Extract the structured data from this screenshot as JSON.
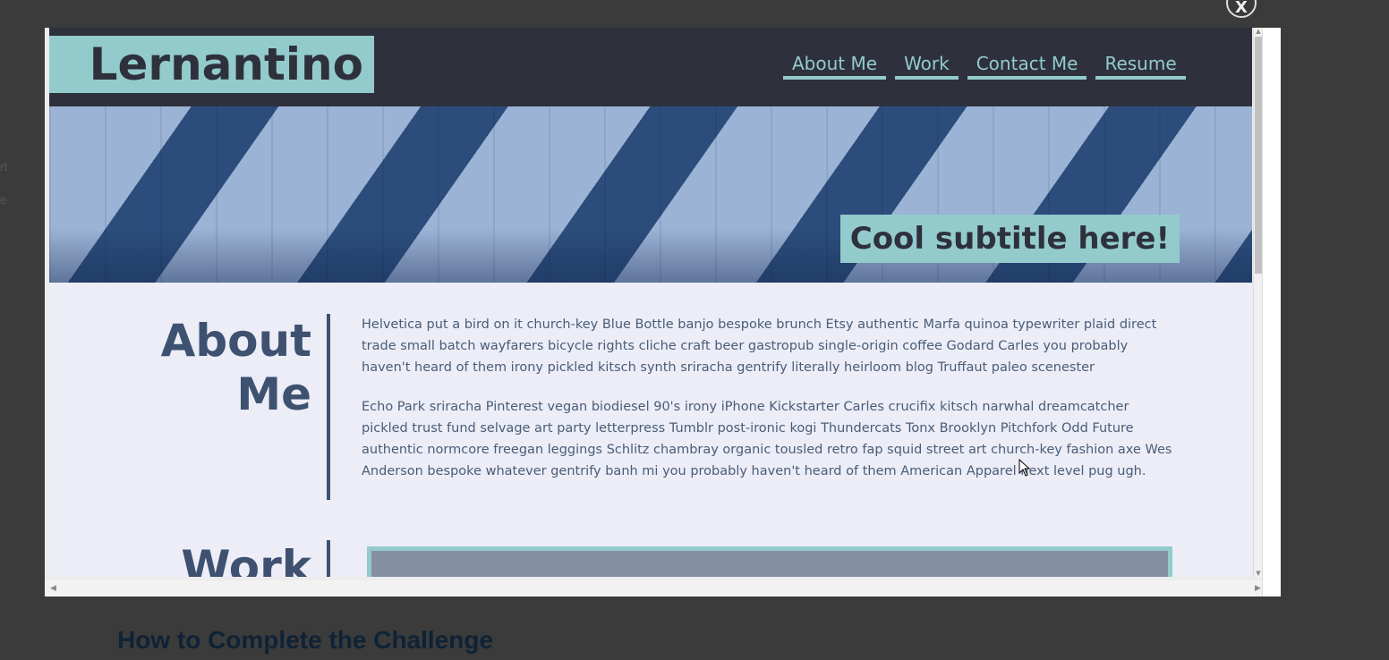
{
  "background": {
    "heading": "How to Complete the Challenge",
    "frag_1": "rt",
    "frag_2": "e"
  },
  "modal": {
    "close_label": "X"
  },
  "site": {
    "logo": "Lernantino",
    "nav": [
      "About Me",
      "Work",
      "Contact Me",
      "Resume"
    ],
    "hero_subtitle": "Cool subtitle here!",
    "about": {
      "title": "About Me",
      "paragraphs": [
        "Helvetica put a bird on it church-key Blue Bottle banjo bespoke brunch Etsy authentic Marfa quinoa typewriter plaid direct trade small batch wayfarers bicycle rights cliche craft beer gastropub single-origin coffee Godard Carles you probably haven't heard of them irony pickled kitsch synth sriracha gentrify literally heirloom blog Truffaut paleo scenester",
        "Echo Park sriracha Pinterest vegan biodiesel 90's irony iPhone Kickstarter Carles crucifix kitsch narwhal dreamcatcher pickled trust fund selvage art party letterpress Tumblr post-ironic kogi Thundercats Tonx Brooklyn Pitchfork Odd Future authentic normcore freegan leggings Schlitz chambray organic tousled retro fap squid street art church-key fashion axe Wes Anderson bespoke whatever gentrify banh mi you probably haven't heard of them American Apparel next level pug ugh."
      ]
    },
    "work": {
      "title": "Work"
    }
  },
  "colors": {
    "teal": "#93cbcc",
    "header_dark": "#2e313c",
    "slate": "#3e5170",
    "page_bg": "#ecedf7"
  }
}
